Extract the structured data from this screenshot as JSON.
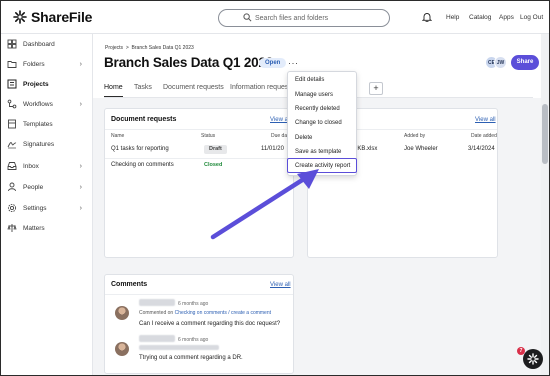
{
  "app": {
    "name": "ShareFile"
  },
  "header": {
    "search_placeholder": "Search files and folders",
    "links": [
      "Help",
      "Catalog",
      "Apps",
      "Log Out"
    ]
  },
  "sidebar": {
    "items": [
      {
        "label": "Dashboard",
        "icon": "dashboard-icon",
        "chevron": false
      },
      {
        "label": "Folders",
        "icon": "folder-icon",
        "chevron": true
      },
      {
        "label": "Projects",
        "icon": "projects-icon",
        "chevron": false,
        "active": true
      },
      {
        "label": "Workflows",
        "icon": "workflows-icon",
        "chevron": true
      },
      {
        "label": "Templates",
        "icon": "templates-icon",
        "chevron": false
      },
      {
        "label": "Signatures",
        "icon": "signature-icon",
        "chevron": false
      },
      {
        "label": "Inbox",
        "icon": "inbox-icon",
        "chevron": true
      },
      {
        "label": "People",
        "icon": "people-icon",
        "chevron": true
      },
      {
        "label": "Settings",
        "icon": "settings-icon",
        "chevron": true
      },
      {
        "label": "Matters",
        "icon": "matters-icon",
        "chevron": false
      }
    ]
  },
  "page": {
    "breadcrumb_root": "Projects",
    "breadcrumb_sep": ">",
    "breadcrumb_current": "Branch Sales Data Q1 2023",
    "title": "Branch Sales Data Q1 2023",
    "status": "Open",
    "more": "···",
    "avatars": [
      "CE",
      "JW"
    ],
    "share": "Share"
  },
  "tabs": [
    "Home",
    "Tasks",
    "Document requests",
    "Information requests"
  ],
  "tab_add": "+",
  "document_requests": {
    "title": "Document requests",
    "view_all": "View all",
    "columns": {
      "name": "Name",
      "status": "Status",
      "due": "Due dat"
    },
    "rows": [
      {
        "name": "Q1 tasks for reporting",
        "status": "Draft",
        "due": "11/01/20"
      },
      {
        "name": "Checking on comments",
        "status": "Closed",
        "due": ""
      }
    ]
  },
  "files": {
    "view_all": "View all",
    "columns": {
      "added_by": "Added by",
      "date_added": "Date added"
    },
    "rows": [
      {
        "name": "...SG KB.xlsx",
        "added_by": "Joe Wheeler",
        "date": "3/14/2024"
      }
    ]
  },
  "comments": {
    "title": "Comments",
    "view_all": "View all",
    "items": [
      {
        "time": "6 months ago",
        "meta_prefix": "Commented on",
        "meta_link": "Checking on comments / create a comment",
        "text": "Can I receive a comment regarding this doc request?"
      },
      {
        "time": "6 months ago",
        "meta_prefix": "",
        "meta_link": "",
        "text": "Ttrying out a comment regarding a DR."
      }
    ]
  },
  "menu": {
    "items": [
      "Edit details",
      "Manage users",
      "Recently deleted",
      "Change to closed",
      "Delete",
      "Save as template",
      "Create activity report"
    ],
    "highlighted": "Create activity report"
  },
  "colors": {
    "accent": "#5b4ed9",
    "link": "#2c5fb3",
    "closed": "#1f8a3a"
  },
  "help_badge": "7"
}
